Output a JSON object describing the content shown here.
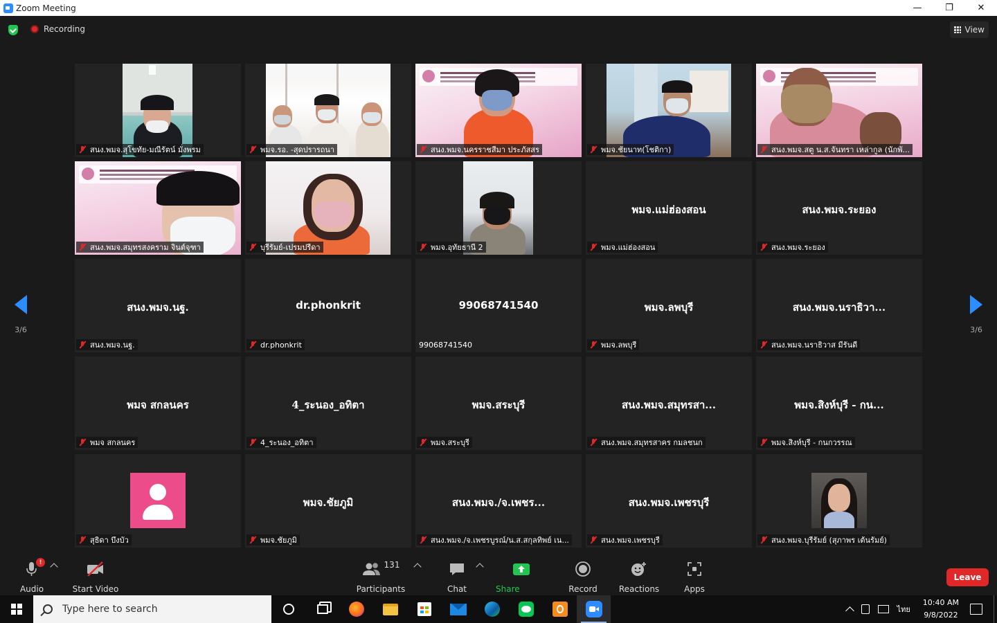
{
  "window": {
    "title": "Zoom Meeting",
    "controls": [
      "—",
      "❐",
      "✕"
    ]
  },
  "topbar": {
    "recording_label": "Recording",
    "view_label": "View"
  },
  "gallery": {
    "page_left": "3/6",
    "page_right": "3/6",
    "tiles": [
      {
        "label": "สนง.พมจ.สุโขทัย-มณีรัตน์ มั่งพรม",
        "video": "room1"
      },
      {
        "label": "พมจ.รอ. -สุดปรารถนา",
        "video": "room2"
      },
      {
        "label": "สนง.พมจ.นครราชสีมา ประภัสสร",
        "video": "room3"
      },
      {
        "label": "พมจ.ชัยนาท(โชติกา)",
        "video": "room4"
      },
      {
        "label": "สนง.พมจ.สตู น.ส.จันทรา เหล่ากูล (นักพั...",
        "video": "room5"
      },
      {
        "label": "สนง.พมจ.สมุทรสงคราม จินต์จุฑา",
        "video": "room6"
      },
      {
        "label": "บุรีรัมย์-เปรมปรีดา",
        "video": "room7"
      },
      {
        "label": "พมจ.อุทัยธานี 2",
        "video": "room8"
      },
      {
        "name": "พมจ.แม่ฮ่องสอน",
        "label": "พมจ.แม่ฮ่องสอน"
      },
      {
        "name": "สนง.พมจ.ระยอง",
        "label": "สนง.พมจ.ระยอง"
      },
      {
        "name": "สนง.พมจ.นฐ.",
        "label": "สนง.พมจ.นฐ."
      },
      {
        "name": "dr.phonkrit",
        "label": "dr.phonkrit"
      },
      {
        "name": "99068741540",
        "label": "99068741540",
        "muted_icon": false
      },
      {
        "name": "พมจ.ลพบุรี",
        "label": "พมจ.ลพบุรี"
      },
      {
        "name": "สนง.พมจ.นราธิวา...",
        "label": "สนง.พมจ.นราธิวาส มีรันดี"
      },
      {
        "name": "พมจ สกลนคร",
        "label": "พมจ สกลนคร"
      },
      {
        "name": "4_ระนอง_อทิตา",
        "label": "4_ระนอง_อทิตา"
      },
      {
        "name": "พมจ.สระบุรี",
        "label": "พมจ.สระบุรี"
      },
      {
        "name": "สนง.พมจ.สมุทรสา...",
        "label": "สนง.พมจ.สมุทรสาคร กมลชนก"
      },
      {
        "name": "พมจ.สิงห์บุรี  - กน...",
        "label": "พมจ.สิงห์บุรี  - กนกวรรณ"
      },
      {
        "avatar": "pink",
        "label": "สุธิดา บึงบัว"
      },
      {
        "name": "พมจ.ชัยภูมิ",
        "label": "พมจ.ชัยภูมิ"
      },
      {
        "name": "สนง.พมจ./จ.เพชร...",
        "label": "สนง.พมจ./จ.เพชรบูรณ์/น.ส.สกุลทิพย์ เน..."
      },
      {
        "name": "สนง.พมจ.เพชรบุรี",
        "label": "สนง.พมจ.เพชรบุรี"
      },
      {
        "avatar": "photo",
        "label": "สนง.พมจ.บุรีรัมย์ (สุภาพร เต้นรัมย์)"
      }
    ]
  },
  "toolbar": {
    "audio_label": "Audio",
    "audio_alert": "!",
    "video_label": "Start Video",
    "participants_count": "131",
    "participants_label": "Participants",
    "chat_label": "Chat",
    "share_label": "Share Screen",
    "record_label": "Record",
    "reactions_label": "Reactions",
    "apps_label": "Apps",
    "leave_label": "Leave",
    "share_color": "#23c552",
    "leave_color": "#e02828"
  },
  "taskbar": {
    "search_placeholder": "Type here to search",
    "apps": [
      "cortana-icon",
      "task-view-icon",
      "firefox-icon",
      "file-explorer-icon",
      "store-icon",
      "mail-icon",
      "edge-icon",
      "line-icon",
      "pdf-icon",
      "zoom-icon"
    ],
    "lang": "ไทย",
    "time": "10:40 AM",
    "date": "9/8/2022"
  }
}
